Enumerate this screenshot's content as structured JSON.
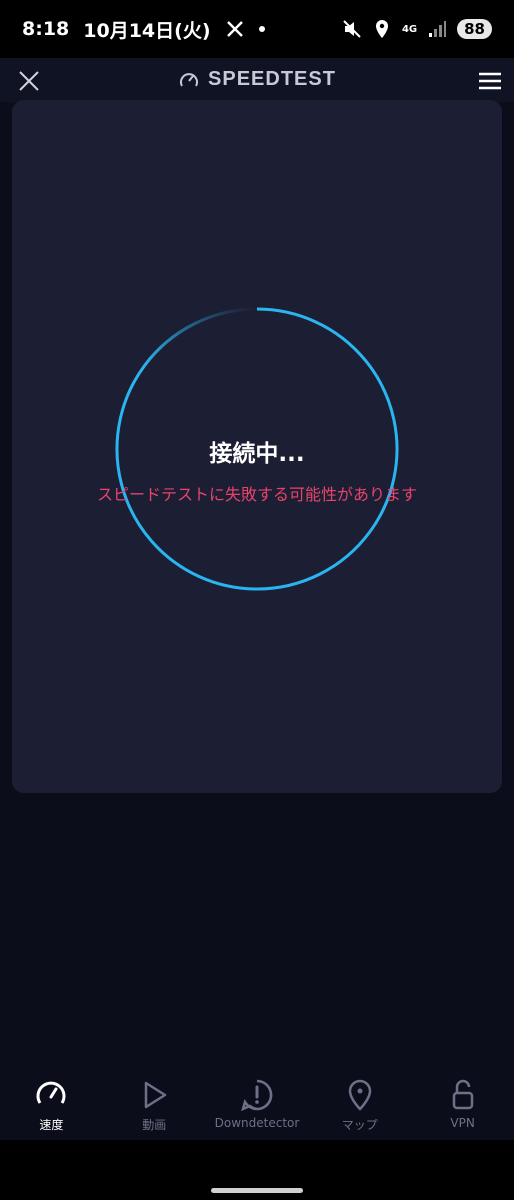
{
  "status_bar": {
    "time": "8:18",
    "date": "10月14日(火)",
    "x_icon": "x-logo-icon",
    "network": "4G",
    "battery": "88"
  },
  "header": {
    "title": "SPEEDTEST"
  },
  "test": {
    "status": "接続中...",
    "warning": "スピードテストに失敗する可能性があります"
  },
  "tabs": [
    {
      "label": "速度",
      "icon": "speedometer-icon",
      "active": true
    },
    {
      "label": "動画",
      "icon": "play-icon",
      "active": false
    },
    {
      "label": "Downdetector",
      "icon": "alert-bubble-icon",
      "active": false
    },
    {
      "label": "マップ",
      "icon": "map-pin-icon",
      "active": false
    },
    {
      "label": "VPN",
      "icon": "unlock-icon",
      "active": false
    }
  ],
  "colors": {
    "accent": "#2ab4f0",
    "warning": "#e8436c",
    "card": "#1c1f33",
    "background": "#0b0d1a"
  }
}
